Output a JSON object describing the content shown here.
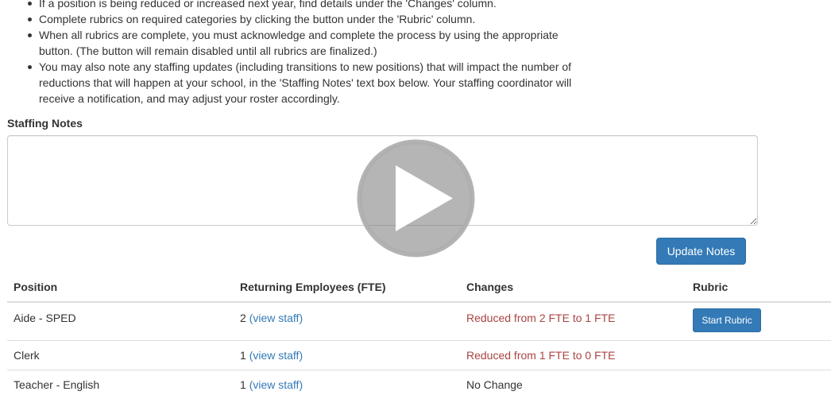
{
  "instructions": [
    "If a position is being reduced or increased next year, find details under the 'Changes' column.",
    "Complete rubrics on required categories by clicking the button under the 'Rubric' column.",
    "When all rubrics are complete, you must acknowledge and complete the process by using the appropriate button. (The button will remain disabled until all rubrics are finalized.)",
    "You may also note any staffing updates (including transitions to new positions) that will impact the number of reductions that will happen at your school, in the 'Staffing Notes' text box below. Your staffing coordinator will receive a notification, and may adjust your roster accordingly."
  ],
  "notes": {
    "label": "Staffing Notes",
    "value": "",
    "update_button": "Update Notes"
  },
  "table": {
    "headers": [
      "Position",
      "Returning Employees (FTE)",
      "Changes",
      "Rubric"
    ],
    "rows": [
      {
        "position": "Aide - SPED",
        "fte": "2",
        "view_link": "(view staff)",
        "change": "Reduced from 2 FTE to 1 FTE",
        "rubric_button": "Start Rubric"
      },
      {
        "position": "Clerk",
        "fte": "1",
        "view_link": "(view staff)",
        "change": "Reduced from 1 FTE to 0 FTE",
        "rubric_button": ""
      },
      {
        "position": "Teacher - English",
        "fte": "1",
        "view_link": "(view staff)",
        "change": "No Change",
        "rubric_button": ""
      }
    ]
  },
  "overlay": {
    "icon": "play-icon"
  },
  "colors": {
    "primary": "#337ab7",
    "danger": "#a94442",
    "text": "#333333"
  }
}
